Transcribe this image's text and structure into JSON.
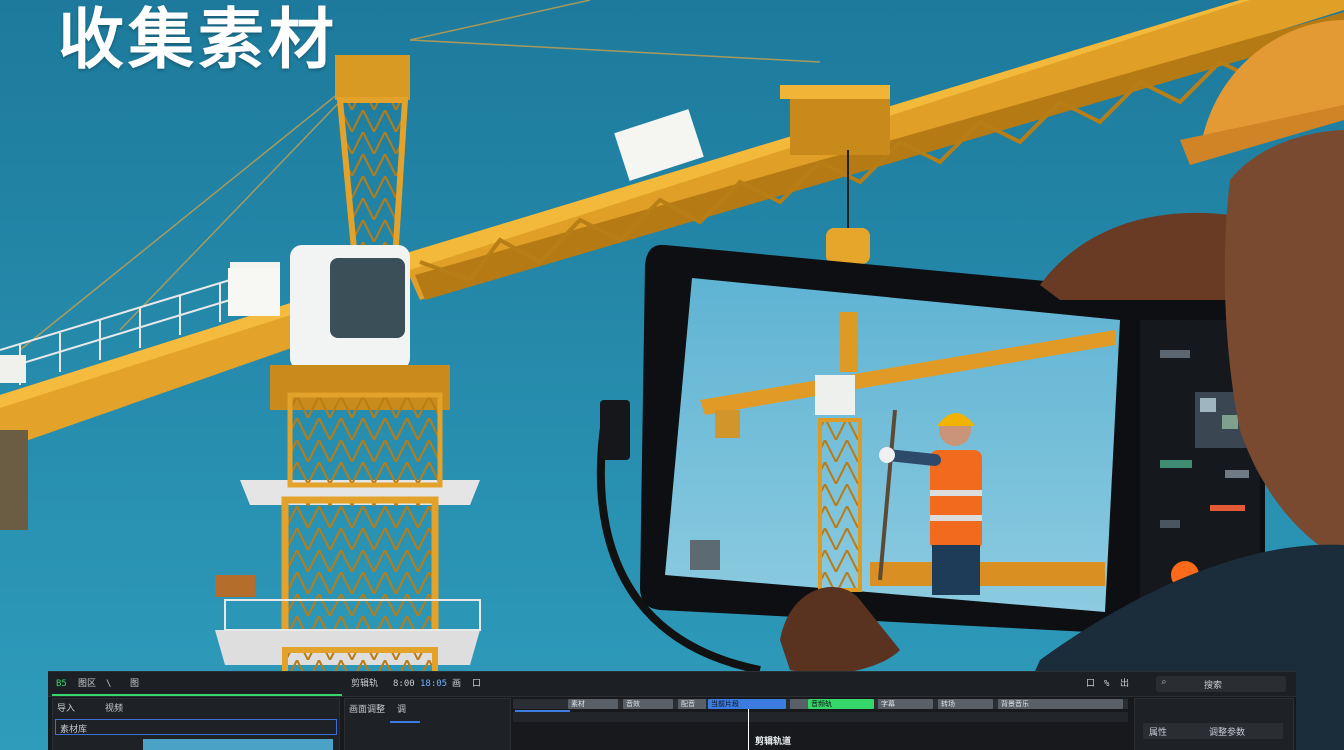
{
  "headline": "收集素材",
  "editor": {
    "toolbar_left": [
      "B5",
      "图区",
      "\\",
      "图"
    ],
    "toolbar_center": [
      "剪辑轨",
      "8:00",
      "18:05",
      "画",
      "口"
    ],
    "toolbar_right": [
      "口",
      "%",
      "出"
    ],
    "media_panel": {
      "title": "素材库",
      "tab_a": "导入",
      "tab_b": "视频"
    },
    "preview_tabs": [
      "画面调整",
      "调"
    ],
    "clips": [
      "素材",
      "音效",
      "配音",
      "字幕",
      "转场",
      "背景音乐"
    ],
    "clip_highlight_blue": "当前片段",
    "clip_highlight_green": "音频轨",
    "playhead_label": "剪辑轨道",
    "inspector": {
      "search_label": "搜索",
      "row_a": "属性",
      "row_b": "调整参数"
    }
  },
  "colors": {
    "sky_top": "#1f7fa0",
    "sky_bottom": "#2e98b8",
    "crane": "#e3a22a",
    "editor_green": "#37d66b",
    "editor_blue": "#3c7be0",
    "vest": "#f26a1d"
  }
}
